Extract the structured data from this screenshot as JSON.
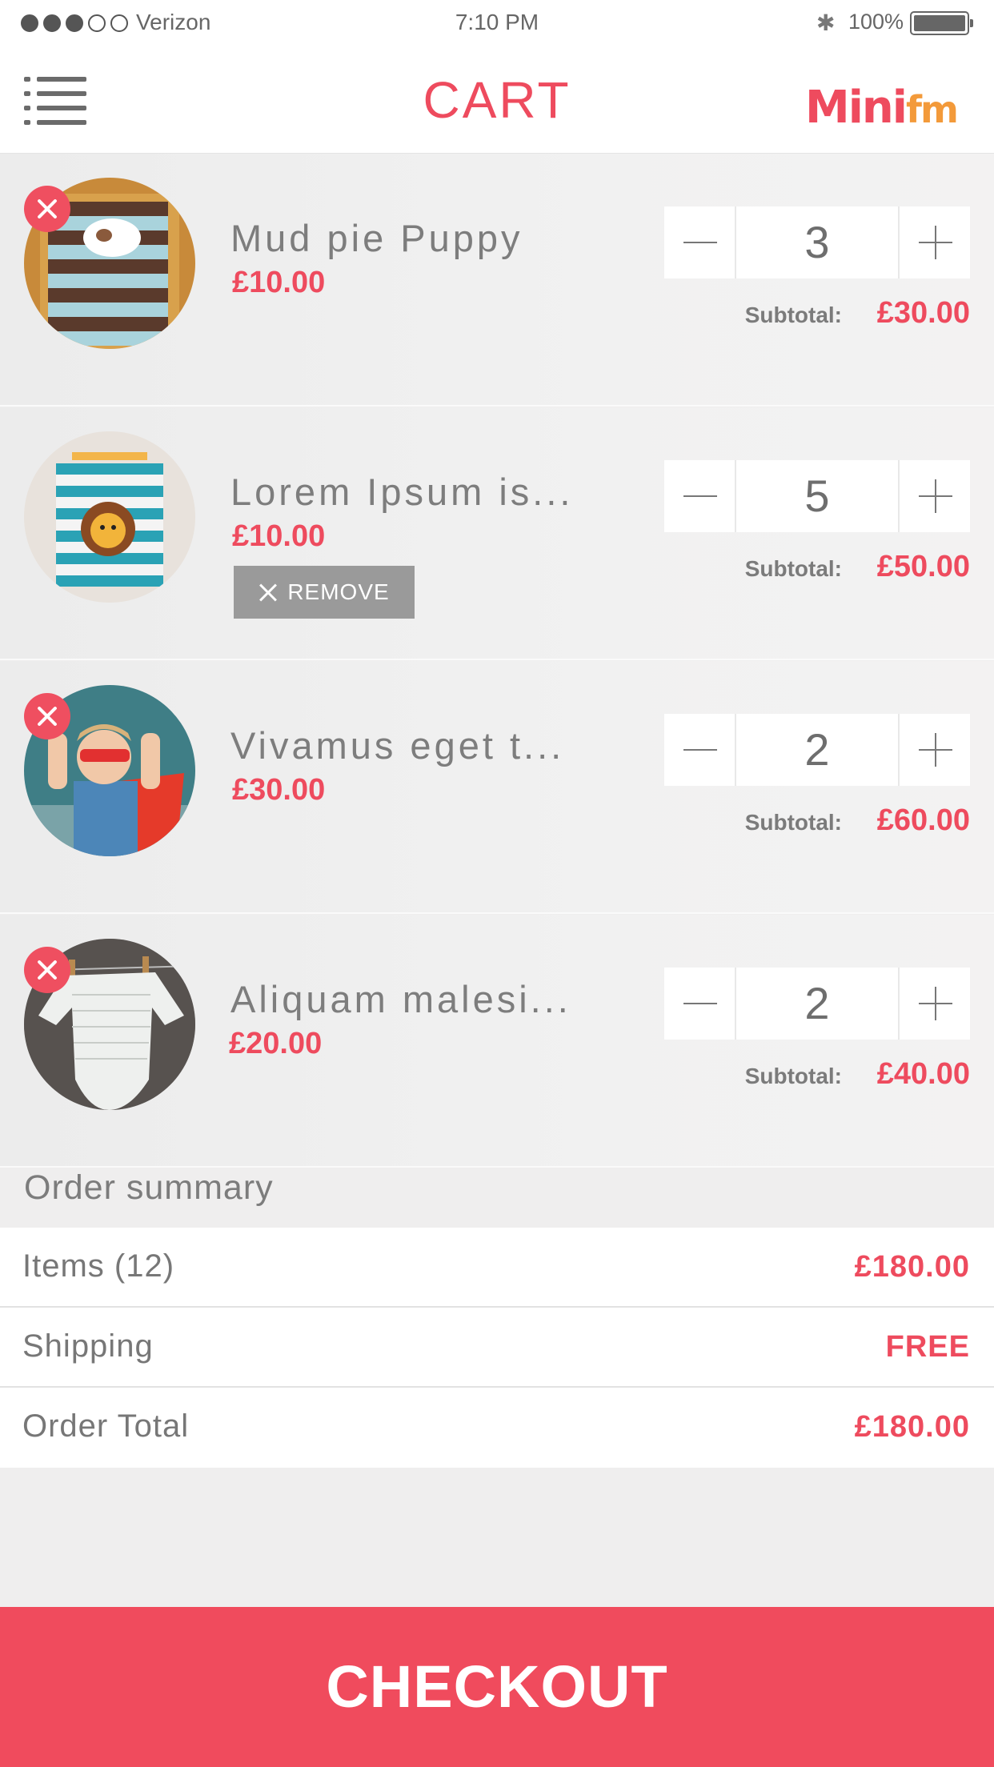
{
  "status_bar": {
    "carrier": "Verizon",
    "time": "7:10 PM",
    "battery": "100%",
    "signal_bars": 3,
    "signal_total": 5
  },
  "header": {
    "title": "CART",
    "logo_text_main": "Mini",
    "logo_text_accent": "fm"
  },
  "cart": {
    "items": [
      {
        "name": "Mud pie Puppy",
        "price": "£10.00",
        "quantity": "3",
        "subtotal_label": "Subtotal:",
        "subtotal": "£30.00",
        "image": "striped-pajamas-photo"
      },
      {
        "name": "Lorem Ipsum is...",
        "price": "£10.00",
        "quantity": "5",
        "subtotal_label": "Subtotal:",
        "subtotal": "£50.00",
        "image": "lion-romper-photo",
        "remove_label": "REMOVE"
      },
      {
        "name": "Vivamus eget t...",
        "price": "£30.00",
        "quantity": "2",
        "subtotal_label": "Subtotal:",
        "subtotal": "£60.00",
        "image": "superhero-girl-photo"
      },
      {
        "name": "Aliquam malesi...",
        "price": "£20.00",
        "quantity": "2",
        "subtotal_label": "Subtotal:",
        "subtotal": "£40.00",
        "image": "baby-bodysuit-photo"
      }
    ]
  },
  "summary": {
    "heading": "Order summary",
    "rows": [
      {
        "label": "Items (12)",
        "value": "£180.00"
      },
      {
        "label": "Shipping",
        "value": "FREE"
      },
      {
        "label": "Order Total",
        "value": "£180.00"
      }
    ]
  },
  "checkout_label": "CHECKOUT",
  "colors": {
    "accent": "#ee4b5e",
    "checkout": "#f04b5d",
    "text_gray": "#7b7b7b",
    "remove_button": "#9a9a9a"
  }
}
